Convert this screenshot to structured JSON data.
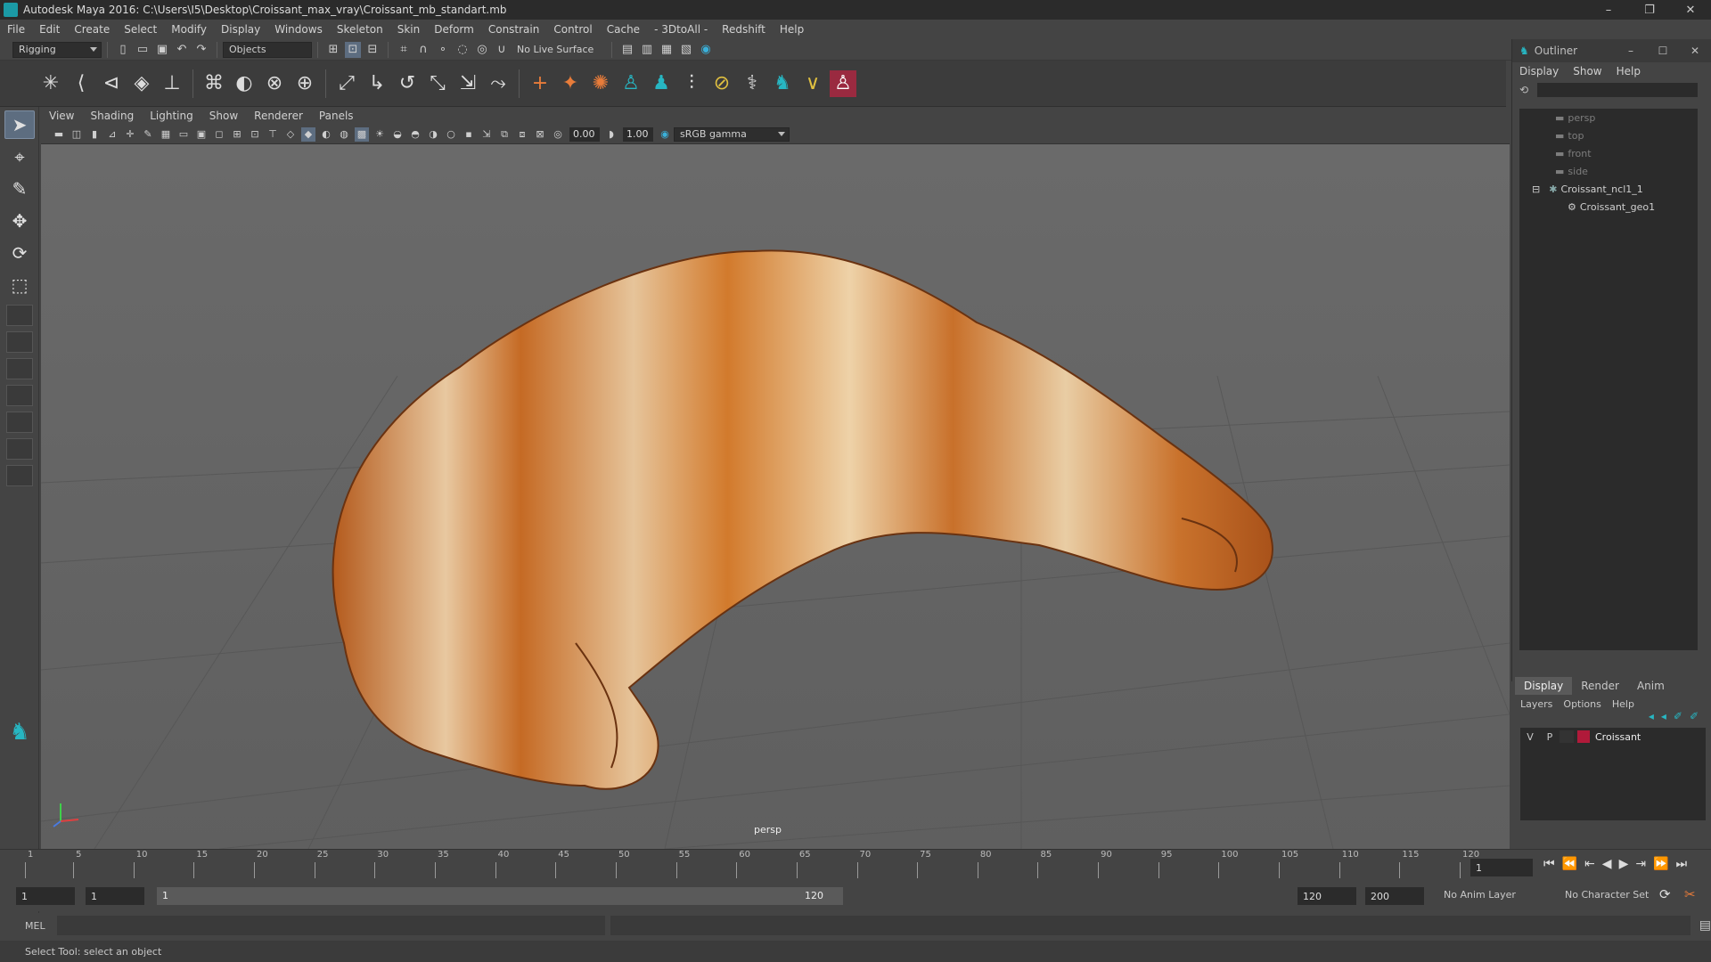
{
  "window": {
    "title": "Autodesk Maya 2016: C:\\Users\\I5\\Desktop\\Croissant_max_vray\\Croissant_mb_standart.mb"
  },
  "menubar": [
    "File",
    "Edit",
    "Create",
    "Select",
    "Modify",
    "Display",
    "Windows",
    "Skeleton",
    "Skin",
    "Deform",
    "Constrain",
    "Control",
    "Cache",
    "- 3DtoAll -",
    "Redshift",
    "Help"
  ],
  "statusline": {
    "menuset": "Rigging",
    "select_mode": "Objects",
    "live_surface": "No Live Surface"
  },
  "viewport": {
    "menu": [
      "View",
      "Shading",
      "Lighting",
      "Show",
      "Renderer",
      "Panels"
    ],
    "exposure": "0.00",
    "gamma": "1.00",
    "color_space": "sRGB gamma",
    "camera_label": "persp"
  },
  "outliner": {
    "title": "Outliner",
    "menu": [
      "Display",
      "Show",
      "Help"
    ],
    "items": [
      {
        "label": "persp",
        "dim": true
      },
      {
        "label": "top",
        "dim": true
      },
      {
        "label": "front",
        "dim": true
      },
      {
        "label": "side",
        "dim": true
      },
      {
        "label": "Croissant_ncl1_1",
        "dim": false
      },
      {
        "label": "Croissant_geo1",
        "dim": false
      }
    ]
  },
  "layers": {
    "tabs": [
      "Display",
      "Render",
      "Anim"
    ],
    "menu": [
      "Layers",
      "Options",
      "Help"
    ],
    "layer": {
      "v": "V",
      "p": "P",
      "name": "Croissant",
      "color": "#b01a3a"
    }
  },
  "timeline": {
    "ticks": [
      "1",
      "5",
      "10",
      "15",
      "20",
      "25",
      "30",
      "35",
      "40",
      "45",
      "50",
      "55",
      "60",
      "65",
      "70",
      "75",
      "80",
      "85",
      "90",
      "95",
      "100",
      "105",
      "110",
      "115",
      "120"
    ],
    "current_frame": "1"
  },
  "range": {
    "start": "1",
    "playback_start": "1",
    "slider_start": "1",
    "slider_end": "120",
    "playback_end": "120",
    "end": "200",
    "anim_layer": "No Anim Layer",
    "character_set": "No Character Set"
  },
  "cmdline": {
    "label": "MEL"
  },
  "helpline": {
    "text": "Select Tool: select an object"
  }
}
